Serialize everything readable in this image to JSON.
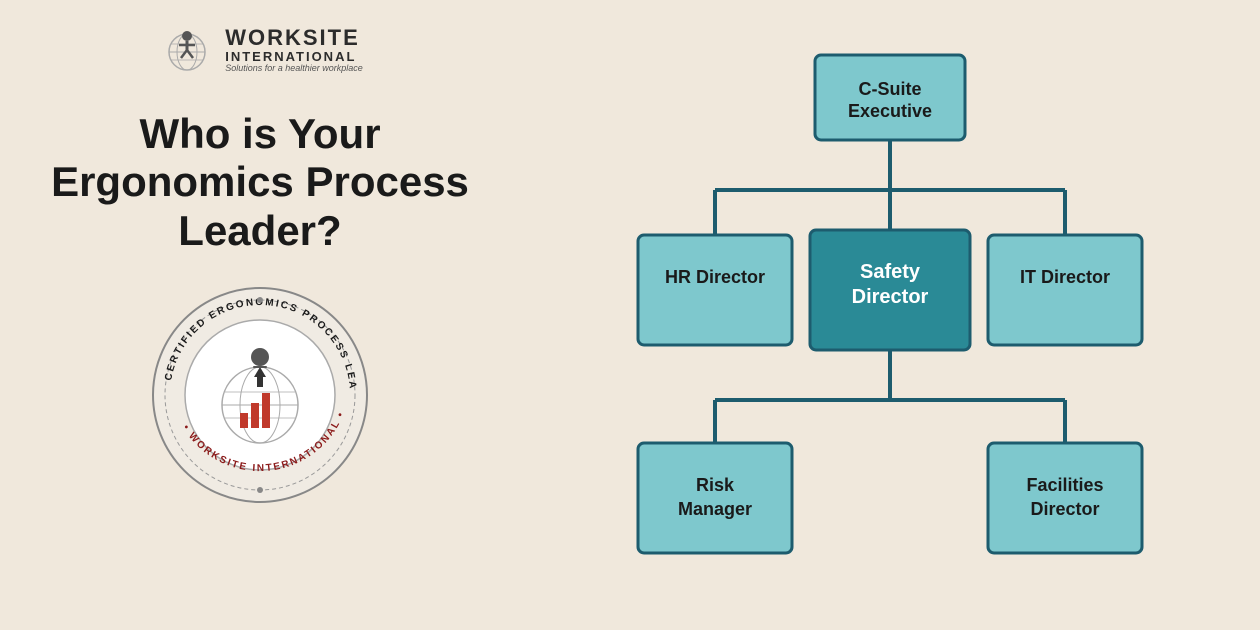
{
  "logo": {
    "main_text": "WORKSITE",
    "sub_text1": "INTERNATIONAL",
    "tagline": "Solutions for a healthier workplace"
  },
  "headline": "Who is Your Ergonomics Process Leader?",
  "badge": {
    "circular_text_top": "CERTIFIED ERGONOMICS PROCESS LEADER",
    "circular_text_bottom": "WORKSITE INTERNATIONAL"
  },
  "org_chart": {
    "level0": {
      "label": "C-Suite\nExecutive"
    },
    "level1": [
      {
        "label": "HR Director",
        "highlight": false
      },
      {
        "label": "Safety\nDirector",
        "highlight": true
      },
      {
        "label": "IT Director",
        "highlight": false
      }
    ],
    "level2": [
      {
        "label": "Risk\nManager",
        "highlight": false
      },
      {
        "label": "Facilities\nDirector",
        "highlight": false
      }
    ]
  }
}
